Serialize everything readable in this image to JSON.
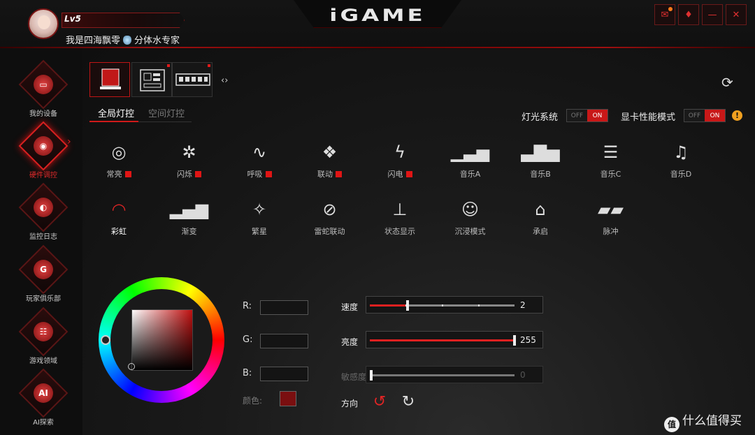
{
  "app": {
    "logo": "iGAME"
  },
  "user": {
    "level": "Lv5",
    "name": "我是四海飘零",
    "badge": "分体水专家"
  },
  "window_controls": [
    {
      "name": "notification-icon",
      "glyph": "✉"
    },
    {
      "name": "skin-icon",
      "glyph": "♦"
    },
    {
      "name": "minimize-icon",
      "glyph": "—"
    },
    {
      "name": "close-icon",
      "glyph": "✕"
    }
  ],
  "sidebar": {
    "items": [
      {
        "label": "我的设备",
        "icon": "monitor-icon",
        "glyph": "▭"
      },
      {
        "label": "硬件调控",
        "icon": "control-icon",
        "glyph": "◉"
      },
      {
        "label": "监控日志",
        "icon": "gauge-icon",
        "glyph": "◐"
      },
      {
        "label": "玩家俱乐部",
        "icon": "club-icon",
        "glyph": "G"
      },
      {
        "label": "游戏领域",
        "icon": "gamepad-icon",
        "glyph": "☷"
      },
      {
        "label": "AI探索",
        "icon": "ai-icon",
        "glyph": "AI"
      }
    ]
  },
  "devices": {
    "more_glyph": "‹›"
  },
  "subtabs": {
    "global": "全局灯控",
    "space": "空间灯控"
  },
  "toggles": {
    "light_system": {
      "label": "灯光系统",
      "off": "OFF",
      "on": "ON"
    },
    "gpu_perf": {
      "label": "显卡性能模式",
      "off": "OFF",
      "on": "ON"
    }
  },
  "effects": [
    {
      "label": "常亮",
      "glyph": "◎",
      "icon": "static-icon",
      "marked": true
    },
    {
      "label": "闪烁",
      "glyph": "✲",
      "icon": "flash-icon",
      "marked": true
    },
    {
      "label": "呼吸",
      "glyph": "∿",
      "icon": "breath-icon",
      "marked": true
    },
    {
      "label": "联动",
      "glyph": "❖",
      "icon": "sync-icon",
      "marked": true
    },
    {
      "label": "闪电",
      "glyph": "ϟ",
      "icon": "lightning-icon",
      "marked": true
    },
    {
      "label": "音乐A",
      "glyph": "▁▃▅",
      "icon": "music-a-icon",
      "marked": false
    },
    {
      "label": "音乐B",
      "glyph": "▃▇▅",
      "icon": "music-b-icon",
      "marked": false
    },
    {
      "label": "音乐C",
      "glyph": "☰",
      "icon": "music-c-icon",
      "marked": false
    },
    {
      "label": "音乐D",
      "glyph": "♫",
      "icon": "music-d-icon",
      "marked": false
    },
    {
      "label": "彩虹",
      "glyph": "◠",
      "icon": "rainbow-icon",
      "marked": false,
      "active": true
    },
    {
      "label": "渐变",
      "glyph": "▂▄▆",
      "icon": "gradient-icon",
      "marked": false
    },
    {
      "label": "繁星",
      "glyph": "✧",
      "icon": "stars-icon",
      "marked": false
    },
    {
      "label": "雷蛇联动",
      "glyph": "⊘",
      "icon": "razer-icon",
      "marked": false
    },
    {
      "label": "状态显示",
      "glyph": "⊥",
      "icon": "status-icon",
      "marked": false
    },
    {
      "label": "沉浸模式",
      "glyph": "☺",
      "icon": "immersive-icon",
      "marked": false
    },
    {
      "label": "承启",
      "glyph": "⌂",
      "icon": "inherit-icon",
      "marked": false
    },
    {
      "label": "脉冲",
      "glyph": "▰▰",
      "icon": "pulse-icon",
      "marked": false
    }
  ],
  "color": {
    "r_label": "R:",
    "g_label": "G:",
    "b_label": "B:",
    "color_label": "颜色:",
    "swatch": "#7a0f10"
  },
  "sliders": {
    "speed": {
      "label": "速度",
      "value": "2",
      "fraction": 0.26
    },
    "brightness": {
      "label": "亮度",
      "value": "255",
      "fraction": 1.0
    },
    "sensitivity": {
      "label": "敏感度",
      "value": "0",
      "fraction": 0.0
    }
  },
  "direction": {
    "label": "方向",
    "ccw_glyph": "↺",
    "cw_glyph": "↻"
  },
  "watermark": {
    "badge": "值",
    "text": "什么值得买"
  }
}
